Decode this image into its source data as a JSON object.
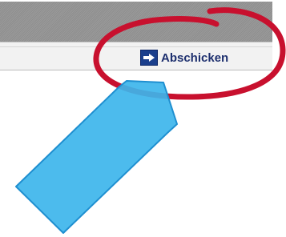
{
  "form": {
    "submit_label": "Abschicken",
    "submit_icon": "arrow-right-icon"
  },
  "annotation": {
    "circle_color": "#c8102e",
    "arrow_color": "#3db5ec",
    "arrow_stroke": "#1f8fd0"
  }
}
